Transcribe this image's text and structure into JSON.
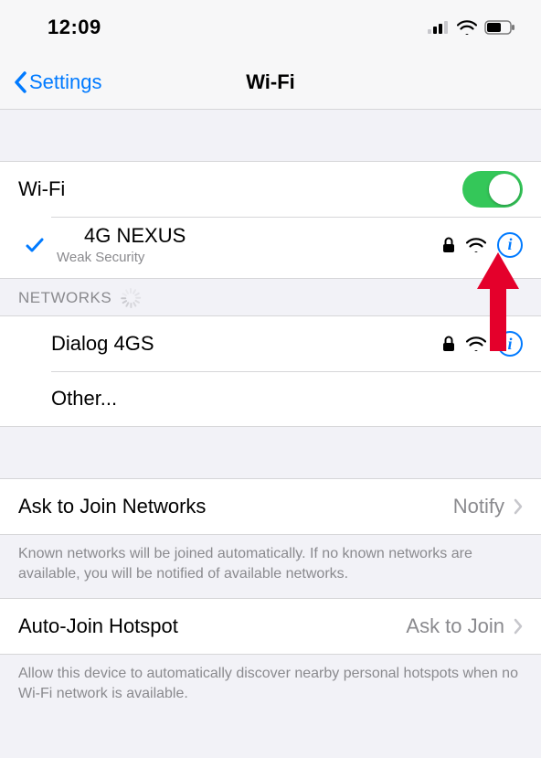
{
  "status_bar": {
    "time": "12:09"
  },
  "nav": {
    "back_label": "Settings",
    "title": "Wi-Fi"
  },
  "wifi": {
    "toggle_label": "Wi-Fi",
    "toggle_on": true,
    "connected": {
      "name": "4G NEXUS",
      "subtitle": "Weak Security"
    }
  },
  "networks": {
    "header": "Networks",
    "items": [
      {
        "name": "Dialog 4GS",
        "locked": true
      }
    ],
    "other_label": "Other..."
  },
  "ask_join": {
    "label": "Ask to Join Networks",
    "value": "Notify",
    "footer": "Known networks will be joined automatically. If no known networks are available, you will be notified of available networks."
  },
  "auto_join": {
    "label": "Auto-Join Hotspot",
    "value": "Ask to Join",
    "footer": "Allow this device to automatically discover nearby personal hotspots when no Wi-Fi network is available."
  }
}
